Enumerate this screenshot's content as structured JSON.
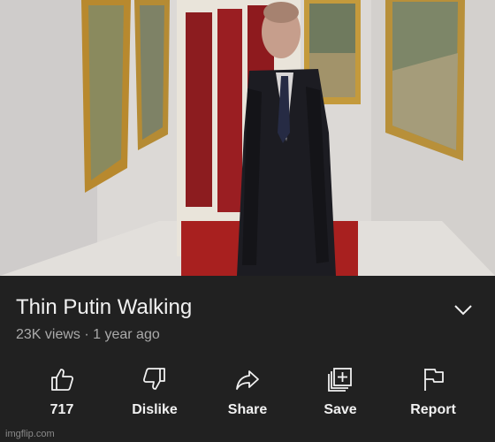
{
  "video": {
    "description_icon": "video-frame"
  },
  "info": {
    "title": "Thin Putin Walking",
    "meta": "23K views · 1 year ago",
    "expand_icon": "chevron-down-icon"
  },
  "actions": [
    {
      "label": "717",
      "icon": "thumbs-up-icon"
    },
    {
      "label": "Dislike",
      "icon": "thumbs-down-icon"
    },
    {
      "label": "Share",
      "icon": "share-icon"
    },
    {
      "label": "Save",
      "icon": "save-playlist-icon"
    },
    {
      "label": "Report",
      "icon": "flag-icon"
    }
  ],
  "watermark": "imgflip.com",
  "colors": {
    "background": "#212121",
    "text_primary": "#f1f1f1",
    "text_secondary": "#aaaaaa"
  }
}
